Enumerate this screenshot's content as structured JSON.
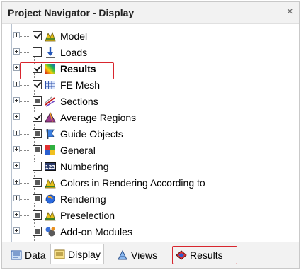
{
  "panel": {
    "title": "Project Navigator - Display",
    "close_glyph": "×"
  },
  "tree": {
    "items": [
      {
        "label": "Model",
        "check": "checked",
        "icon": "model-icon",
        "bold": false
      },
      {
        "label": "Loads",
        "check": "unchecked",
        "icon": "loads-icon",
        "bold": false
      },
      {
        "label": "Results",
        "check": "checked",
        "icon": "results-icon",
        "bold": true
      },
      {
        "label": "FE Mesh",
        "check": "checked",
        "icon": "fe-mesh-icon",
        "bold": false
      },
      {
        "label": "Sections",
        "check": "partial",
        "icon": "sections-icon",
        "bold": false
      },
      {
        "label": "Average Regions",
        "check": "checked",
        "icon": "average-regions-icon",
        "bold": false
      },
      {
        "label": "Guide Objects",
        "check": "partial",
        "icon": "guide-objects-icon",
        "bold": false
      },
      {
        "label": "General",
        "check": "partial",
        "icon": "general-icon",
        "bold": false
      },
      {
        "label": "Numbering",
        "check": "unchecked",
        "icon": "numbering-icon",
        "bold": false
      },
      {
        "label": "Colors in Rendering According to",
        "check": "partial",
        "icon": "colors-icon",
        "bold": false
      },
      {
        "label": "Rendering",
        "check": "partial",
        "icon": "rendering-icon",
        "bold": false
      },
      {
        "label": "Preselection",
        "check": "partial",
        "icon": "preselection-icon",
        "bold": false
      },
      {
        "label": "Add-on Modules",
        "check": "partial",
        "icon": "add-on-modules-icon",
        "bold": false
      }
    ]
  },
  "tabs": [
    {
      "label": "Data",
      "icon": "data-icon"
    },
    {
      "label": "Display",
      "icon": "display-icon",
      "active": true
    },
    {
      "label": "Views",
      "icon": "views-icon"
    },
    {
      "label": "Results",
      "icon": "results-tab-icon"
    }
  ],
  "numbering_icon_text": "123",
  "colors": {
    "highlight": "#d8262e",
    "tree_border": "#b9c3d0"
  }
}
